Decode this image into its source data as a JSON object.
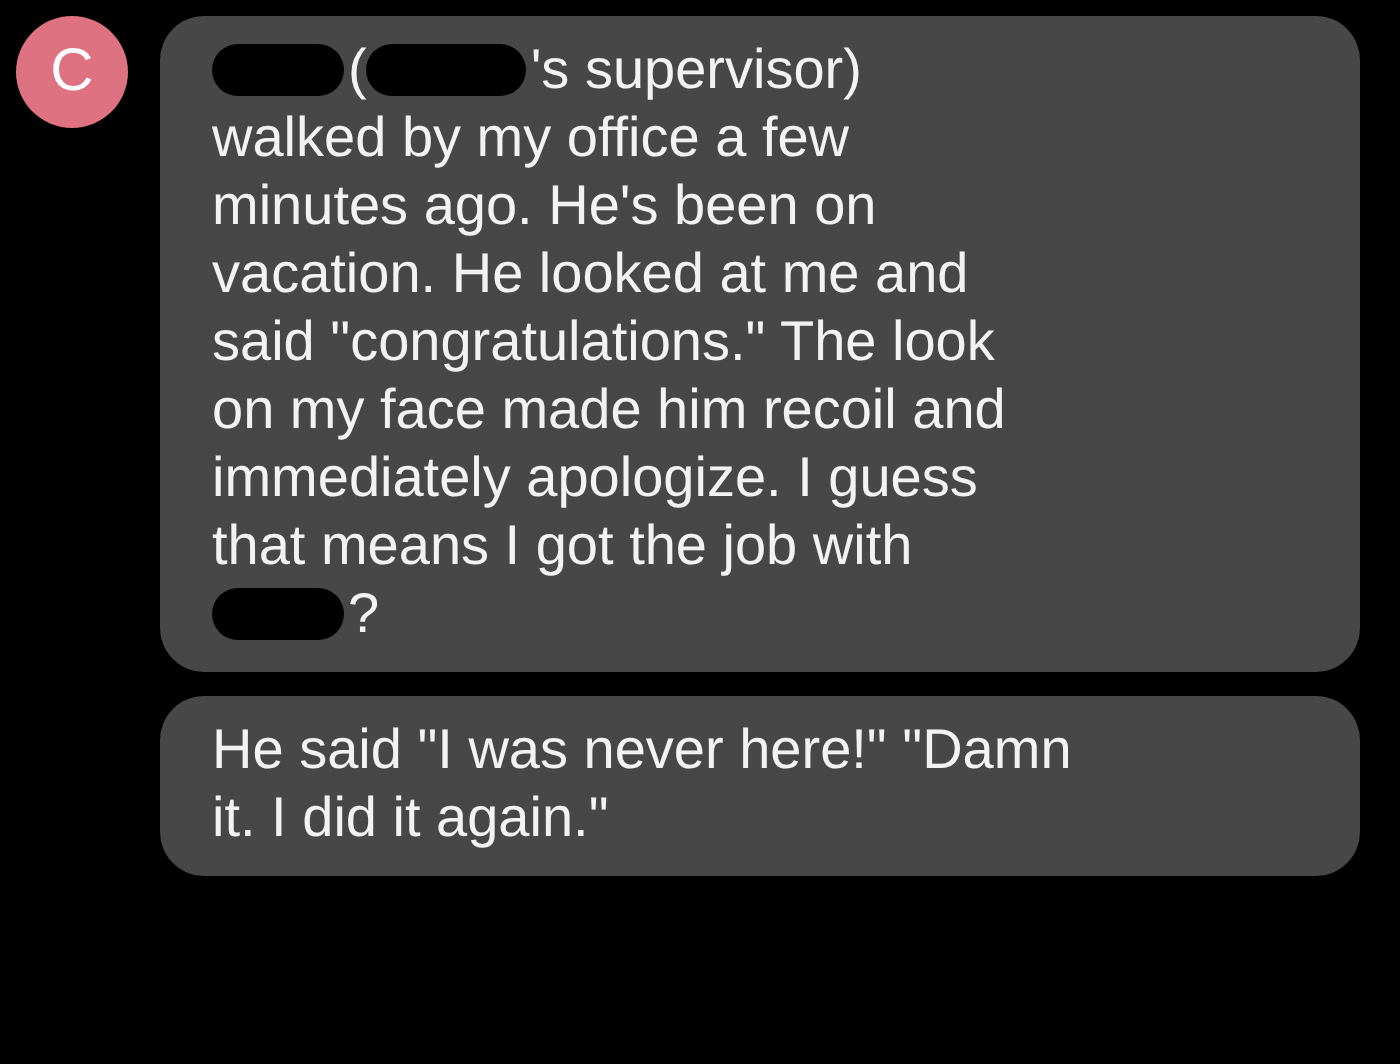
{
  "avatar": {
    "initial": "C"
  },
  "messages": [
    {
      "lines": [
        [
          {
            "kind": "redaction"
          },
          {
            "kind": "text",
            "text": "("
          },
          {
            "kind": "redaction"
          },
          {
            "kind": "text",
            "text": "'s supervisor)"
          }
        ],
        [
          {
            "kind": "text",
            "text": "walked by my office a few"
          }
        ],
        [
          {
            "kind": "text",
            "text": "minutes ago. He's been on"
          }
        ],
        [
          {
            "kind": "text",
            "text": "vacation. He looked at me and"
          }
        ],
        [
          {
            "kind": "text",
            "text": "said \"congratulations.\" The look"
          }
        ],
        [
          {
            "kind": "text",
            "text": "on my face made him recoil and"
          }
        ],
        [
          {
            "kind": "text",
            "text": "immediately apologize. I guess"
          }
        ],
        [
          {
            "kind": "text",
            "text": "that means I got the job with"
          }
        ],
        [
          {
            "kind": "redaction"
          },
          {
            "kind": "text",
            "text": "?"
          }
        ]
      ]
    },
    {
      "lines": [
        [
          {
            "kind": "text",
            "text": "He said \"I was never here!\" \"Damn"
          }
        ],
        [
          {
            "kind": "text",
            "text": "it. I did it again.\""
          }
        ]
      ]
    }
  ]
}
